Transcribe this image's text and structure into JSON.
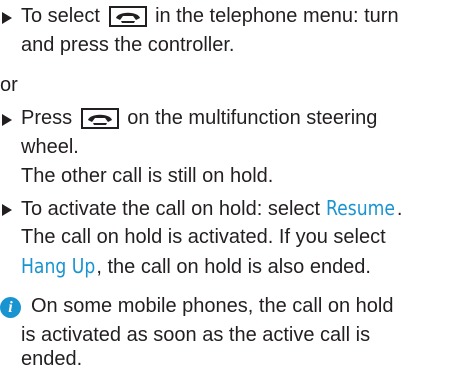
{
  "instructions": {
    "step1": {
      "before": "To select",
      "after": "in the telephone menu: turn",
      "line2": "and press the controller."
    },
    "or_text": "or",
    "step2": {
      "before": "Press",
      "after": "on the multifunction steering",
      "line2": "wheel.",
      "result": "The other call is still on hold."
    },
    "step3": {
      "before": "To activate the call on hold: select",
      "resume_label": "Resume",
      "period": ".",
      "result_line1": "The call on hold is activated. If you select",
      "hangup_label": "Hang Up",
      "result_line2_rest": ", the call on hold is also ended."
    },
    "note": {
      "line1": "On some mobile phones, the call on hold",
      "line2": "is activated as soon as the active call is",
      "line3": "ended."
    }
  },
  "icons": {
    "bullet": "right-triangle-bullet",
    "key": "end-call-key-icon",
    "info": "info-icon"
  },
  "colors": {
    "menu_item": "#1a94d1",
    "info_icon": "#1a94d1"
  }
}
